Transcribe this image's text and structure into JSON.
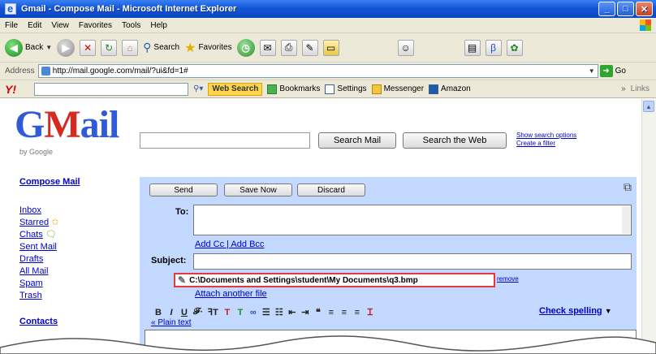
{
  "window": {
    "title": "Gmail - Compose Mail - Microsoft Internet Explorer"
  },
  "menu": [
    "File",
    "Edit",
    "View",
    "Favorites",
    "Tools",
    "Help"
  ],
  "toolbar": {
    "back": "Back",
    "search": "Search",
    "favorites": "Favorites"
  },
  "address": {
    "label": "Address",
    "url": "http://mail.google.com/mail/?ui&fd=1#",
    "go": "Go",
    "links": "Links"
  },
  "yahoo": {
    "logo": "Y!",
    "web_search": "Web Search",
    "bookmarks": "Bookmarks",
    "settings": "Settings",
    "messenger": "Messenger",
    "amazon": "Amazon"
  },
  "gmail": {
    "logo_g": "G",
    "logo_m": "M",
    "logo_ail": "ail",
    "by_google": "by Google",
    "search_mail": "Search Mail",
    "search_web": "Search the Web",
    "show_search_options": "Show search options",
    "create_filter": "Create a filter"
  },
  "sidebar": {
    "compose": "Compose Mail",
    "inbox": "Inbox",
    "starred": "Starred",
    "chats": "Chats",
    "sent": "Sent Mail",
    "drafts": "Drafts",
    "all": "All Mail",
    "spam": "Spam",
    "trash": "Trash",
    "contacts": "Contacts"
  },
  "compose": {
    "send": "Send",
    "save_now": "Save Now",
    "discard": "Discard",
    "to_label": "To:",
    "add_cc_bcc": "Add Cc | Add Bcc",
    "subject_label": "Subject:",
    "attachment": "C:\\Documents and Settings\\student\\My Documents\\q3.bmp",
    "remove": "remove",
    "attach_another": "Attach another file",
    "check_spelling": "Check spelling",
    "plain_text": "« Plain text"
  }
}
